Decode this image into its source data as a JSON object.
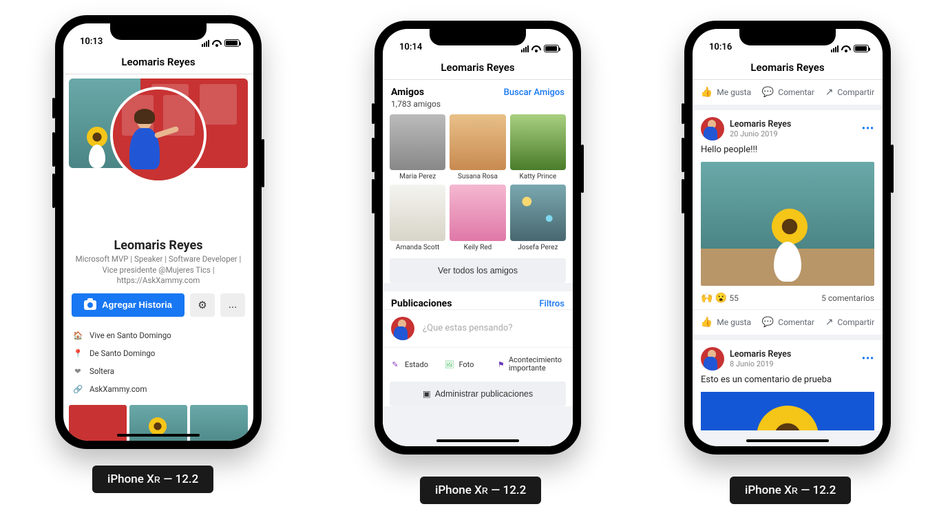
{
  "devices": {
    "label": "iPhone Xʀ — 12.2"
  },
  "phone1": {
    "time": "10:13",
    "title": "Leomaris Reyes",
    "profile": {
      "name": "Leomaris Reyes",
      "bio": "Microsoft MVP | Speaker | Software Developer | Vice presidente @Mujeres Tics | https://AskXammy.com"
    },
    "actions": {
      "addStory": "Agregar Historia",
      "more": "..."
    },
    "info": [
      {
        "icon": "🏠",
        "text": "Vive en Santo Domingo"
      },
      {
        "icon": "📍",
        "text": "De Santo Domingo"
      },
      {
        "icon": "❤",
        "text": "Soltera"
      },
      {
        "icon": "🔗",
        "text": "AskXammy.com"
      }
    ]
  },
  "phone2": {
    "time": "10:14",
    "title": "Leomaris Reyes",
    "friends": {
      "header": "Amigos",
      "link": "Buscar Amigos",
      "count": "1,783 amigos",
      "list": [
        "Maria Perez",
        "Susana Rosa",
        "Katty Prince",
        "Amanda Scott",
        "Keily Red",
        "Josefa Perez"
      ],
      "seeAll": "Ver todos los amigos"
    },
    "posts": {
      "header": "Publicaciones",
      "link": "Filtros",
      "placeholder": "¿Que estas pensando?",
      "items": [
        {
          "icon": "✎",
          "label": "Estado",
          "color": "#8a3ab9"
        },
        {
          "icon": "🖼",
          "label": "Foto",
          "color": "#45bd62"
        },
        {
          "icon": "⚑",
          "label": "Acontecimiento importante",
          "color": "#6a3ab9"
        }
      ],
      "manage": "Administrar publicaciones"
    }
  },
  "phone3": {
    "time": "10:16",
    "title": "Leomaris Reyes",
    "actions": {
      "like": "Me gusta",
      "comment": "Comentar",
      "share": "Compartir"
    },
    "post1": {
      "author": "Leomaris Reyes",
      "date": "20 Junio 2019",
      "text": "Hello people!!!",
      "reactions": "🙌 😮",
      "reactCount": "55",
      "comments": "5 comentarios"
    },
    "post2": {
      "author": "Leomaris Reyes",
      "date": "8 Junio 2019",
      "text": "Esto es un comentario de prueba"
    }
  }
}
